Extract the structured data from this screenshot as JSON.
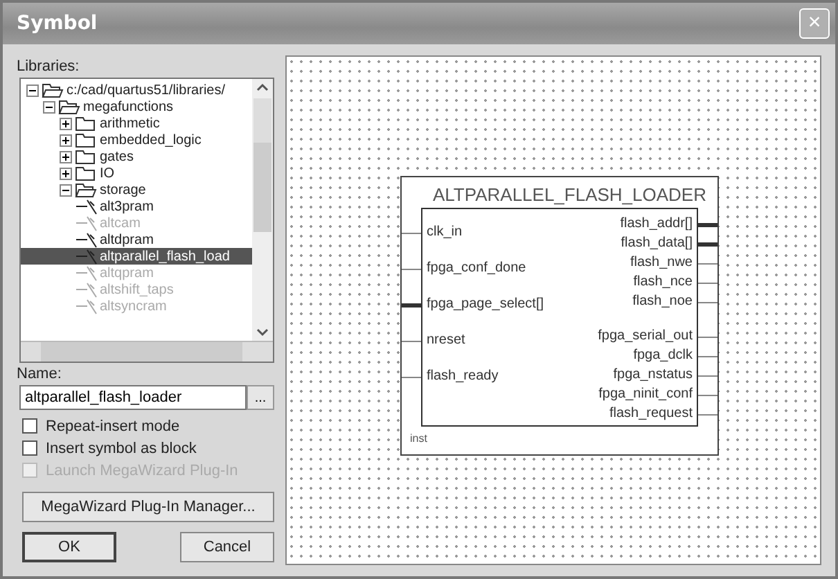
{
  "window": {
    "title": "Symbol",
    "close": "×"
  },
  "libraries": {
    "label": "Libraries:",
    "tree": [
      {
        "label": "c:/cad/quartus51/libraries/",
        "kind": "folder",
        "expanded": true,
        "selected": false,
        "disabled": false,
        "children": [
          {
            "label": "megafunctions",
            "kind": "folder",
            "expanded": true,
            "selected": false,
            "disabled": false,
            "children": [
              {
                "label": "arithmetic",
                "kind": "folder",
                "expanded": false,
                "selected": false,
                "disabled": false
              },
              {
                "label": "embedded_logic",
                "kind": "folder",
                "expanded": false,
                "selected": false,
                "disabled": false
              },
              {
                "label": "gates",
                "kind": "folder",
                "expanded": false,
                "selected": false,
                "disabled": false
              },
              {
                "label": "IO",
                "kind": "folder",
                "expanded": false,
                "selected": false,
                "disabled": false
              },
              {
                "label": "storage",
                "kind": "folder",
                "expanded": true,
                "selected": false,
                "disabled": false,
                "children": [
                  {
                    "label": "alt3pram",
                    "kind": "symbol",
                    "selected": false,
                    "disabled": false
                  },
                  {
                    "label": "altcam",
                    "kind": "symbol",
                    "selected": false,
                    "disabled": true
                  },
                  {
                    "label": "altdpram",
                    "kind": "symbol",
                    "selected": false,
                    "disabled": false
                  },
                  {
                    "label": "altparallel_flash_load",
                    "kind": "symbol",
                    "selected": true,
                    "disabled": false
                  },
                  {
                    "label": "altqpram",
                    "kind": "symbol",
                    "selected": false,
                    "disabled": true
                  },
                  {
                    "label": "altshift_taps",
                    "kind": "symbol",
                    "selected": false,
                    "disabled": true
                  },
                  {
                    "label": "altsyncram",
                    "kind": "symbol",
                    "selected": false,
                    "disabled": true
                  }
                ]
              }
            ]
          }
        ]
      }
    ]
  },
  "name": {
    "label": "Name:",
    "value": "altparallel_flash_loader",
    "browse": "..."
  },
  "options": [
    {
      "label": "Repeat-insert mode",
      "checked": false,
      "disabled": false
    },
    {
      "label": "Insert symbol as block",
      "checked": false,
      "disabled": false
    },
    {
      "label": "Launch MegaWizard Plug-In",
      "checked": false,
      "disabled": true
    }
  ],
  "manager_button": "MegaWizard Plug-In Manager...",
  "buttons": [
    {
      "label": "OK",
      "default": true
    },
    {
      "label": "Cancel",
      "default": false
    }
  ],
  "symbol": {
    "title": "ALTPARALLEL_FLASH_LOADER",
    "instance": "inst",
    "left_pins": [
      {
        "name": "clk_in",
        "bus": false
      },
      {
        "name": "fpga_conf_done",
        "bus": false
      },
      {
        "name": "fpga_page_select[]",
        "bus": true
      },
      {
        "name": "nreset",
        "bus": false
      },
      {
        "name": "flash_ready",
        "bus": false
      }
    ],
    "right_pin_groups": [
      [
        {
          "name": "flash_addr[]",
          "bus": true
        },
        {
          "name": "flash_data[]",
          "bus": true
        },
        {
          "name": "flash_nwe",
          "bus": false
        },
        {
          "name": "flash_nce",
          "bus": false
        },
        {
          "name": "flash_noe",
          "bus": false
        }
      ],
      [
        {
          "name": "fpga_serial_out",
          "bus": false
        },
        {
          "name": "fpga_dclk",
          "bus": false
        },
        {
          "name": "fpga_nstatus",
          "bus": false
        },
        {
          "name": "fpga_ninit_conf",
          "bus": false
        },
        {
          "name": "flash_request",
          "bus": false
        }
      ]
    ]
  }
}
